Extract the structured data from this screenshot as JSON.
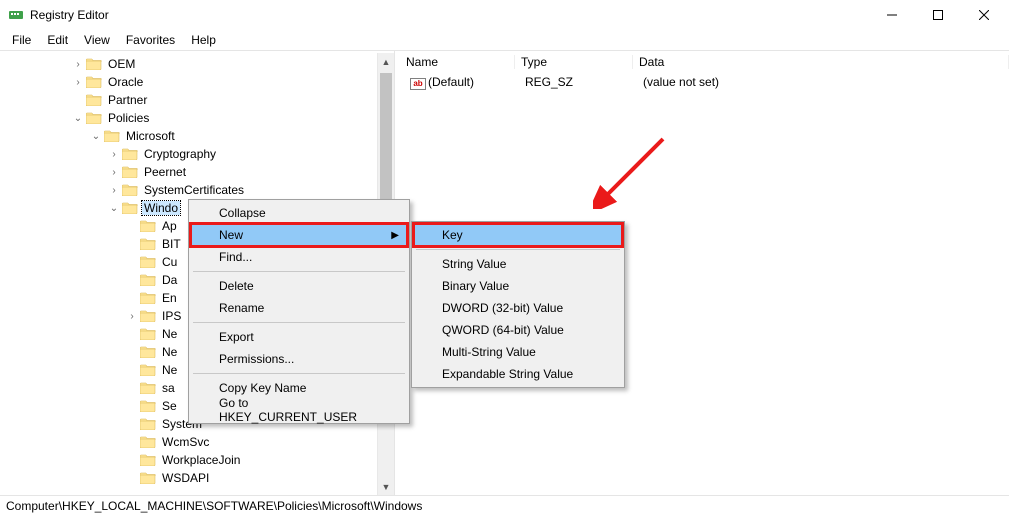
{
  "window": {
    "title": "Registry Editor"
  },
  "menubar": [
    "File",
    "Edit",
    "View",
    "Favorites",
    "Help"
  ],
  "tree": {
    "items": [
      {
        "indent": 4,
        "twisty": ">",
        "label": "OEM"
      },
      {
        "indent": 4,
        "twisty": ">",
        "label": "Oracle"
      },
      {
        "indent": 4,
        "twisty": "",
        "label": "Partner"
      },
      {
        "indent": 4,
        "twisty": "v",
        "label": "Policies"
      },
      {
        "indent": 5,
        "twisty": "v",
        "label": "Microsoft"
      },
      {
        "indent": 6,
        "twisty": ">",
        "label": "Cryptography"
      },
      {
        "indent": 6,
        "twisty": ">",
        "label": "Peernet"
      },
      {
        "indent": 6,
        "twisty": ">",
        "label": "SystemCertificates"
      },
      {
        "indent": 6,
        "twisty": "v",
        "label": "Windo",
        "selected": true
      },
      {
        "indent": 7,
        "twisty": "",
        "label": "Ap"
      },
      {
        "indent": 7,
        "twisty": "",
        "label": "BIT"
      },
      {
        "indent": 7,
        "twisty": "",
        "label": "Cu"
      },
      {
        "indent": 7,
        "twisty": "",
        "label": "Da"
      },
      {
        "indent": 7,
        "twisty": "",
        "label": "En"
      },
      {
        "indent": 7,
        "twisty": ">",
        "label": "IPS"
      },
      {
        "indent": 7,
        "twisty": "",
        "label": "Ne"
      },
      {
        "indent": 7,
        "twisty": "",
        "label": "Ne"
      },
      {
        "indent": 7,
        "twisty": "",
        "label": "Ne"
      },
      {
        "indent": 7,
        "twisty": "",
        "label": "sa"
      },
      {
        "indent": 7,
        "twisty": "",
        "label": "Se"
      },
      {
        "indent": 7,
        "twisty": "",
        "label": "System"
      },
      {
        "indent": 7,
        "twisty": "",
        "label": "WcmSvc"
      },
      {
        "indent": 7,
        "twisty": "",
        "label": "WorkplaceJoin"
      },
      {
        "indent": 7,
        "twisty": "",
        "label": "WSDAPI"
      }
    ]
  },
  "list": {
    "columns": [
      "Name",
      "Type",
      "Data"
    ],
    "rows": [
      {
        "name": "(Default)",
        "type": "REG_SZ",
        "data": "(value not set)"
      }
    ]
  },
  "context_menu_1": {
    "items": [
      {
        "label": "Collapse"
      },
      {
        "label": "New",
        "submenu": true,
        "highlight": true,
        "redbox": true
      },
      {
        "label": "Find..."
      },
      {
        "divider": true
      },
      {
        "label": "Delete"
      },
      {
        "label": "Rename"
      },
      {
        "divider": true
      },
      {
        "label": "Export"
      },
      {
        "label": "Permissions..."
      },
      {
        "divider": true
      },
      {
        "label": "Copy Key Name"
      },
      {
        "label": "Go to HKEY_CURRENT_USER"
      }
    ]
  },
  "context_menu_2": {
    "items": [
      {
        "label": "Key",
        "highlight": true,
        "redbox": true
      },
      {
        "divider": true
      },
      {
        "label": "String Value"
      },
      {
        "label": "Binary Value"
      },
      {
        "label": "DWORD (32-bit) Value"
      },
      {
        "label": "QWORD (64-bit) Value"
      },
      {
        "label": "Multi-String Value"
      },
      {
        "label": "Expandable String Value"
      }
    ]
  },
  "statusbar": {
    "path": "Computer\\HKEY_LOCAL_MACHINE\\SOFTWARE\\Policies\\Microsoft\\Windows"
  }
}
